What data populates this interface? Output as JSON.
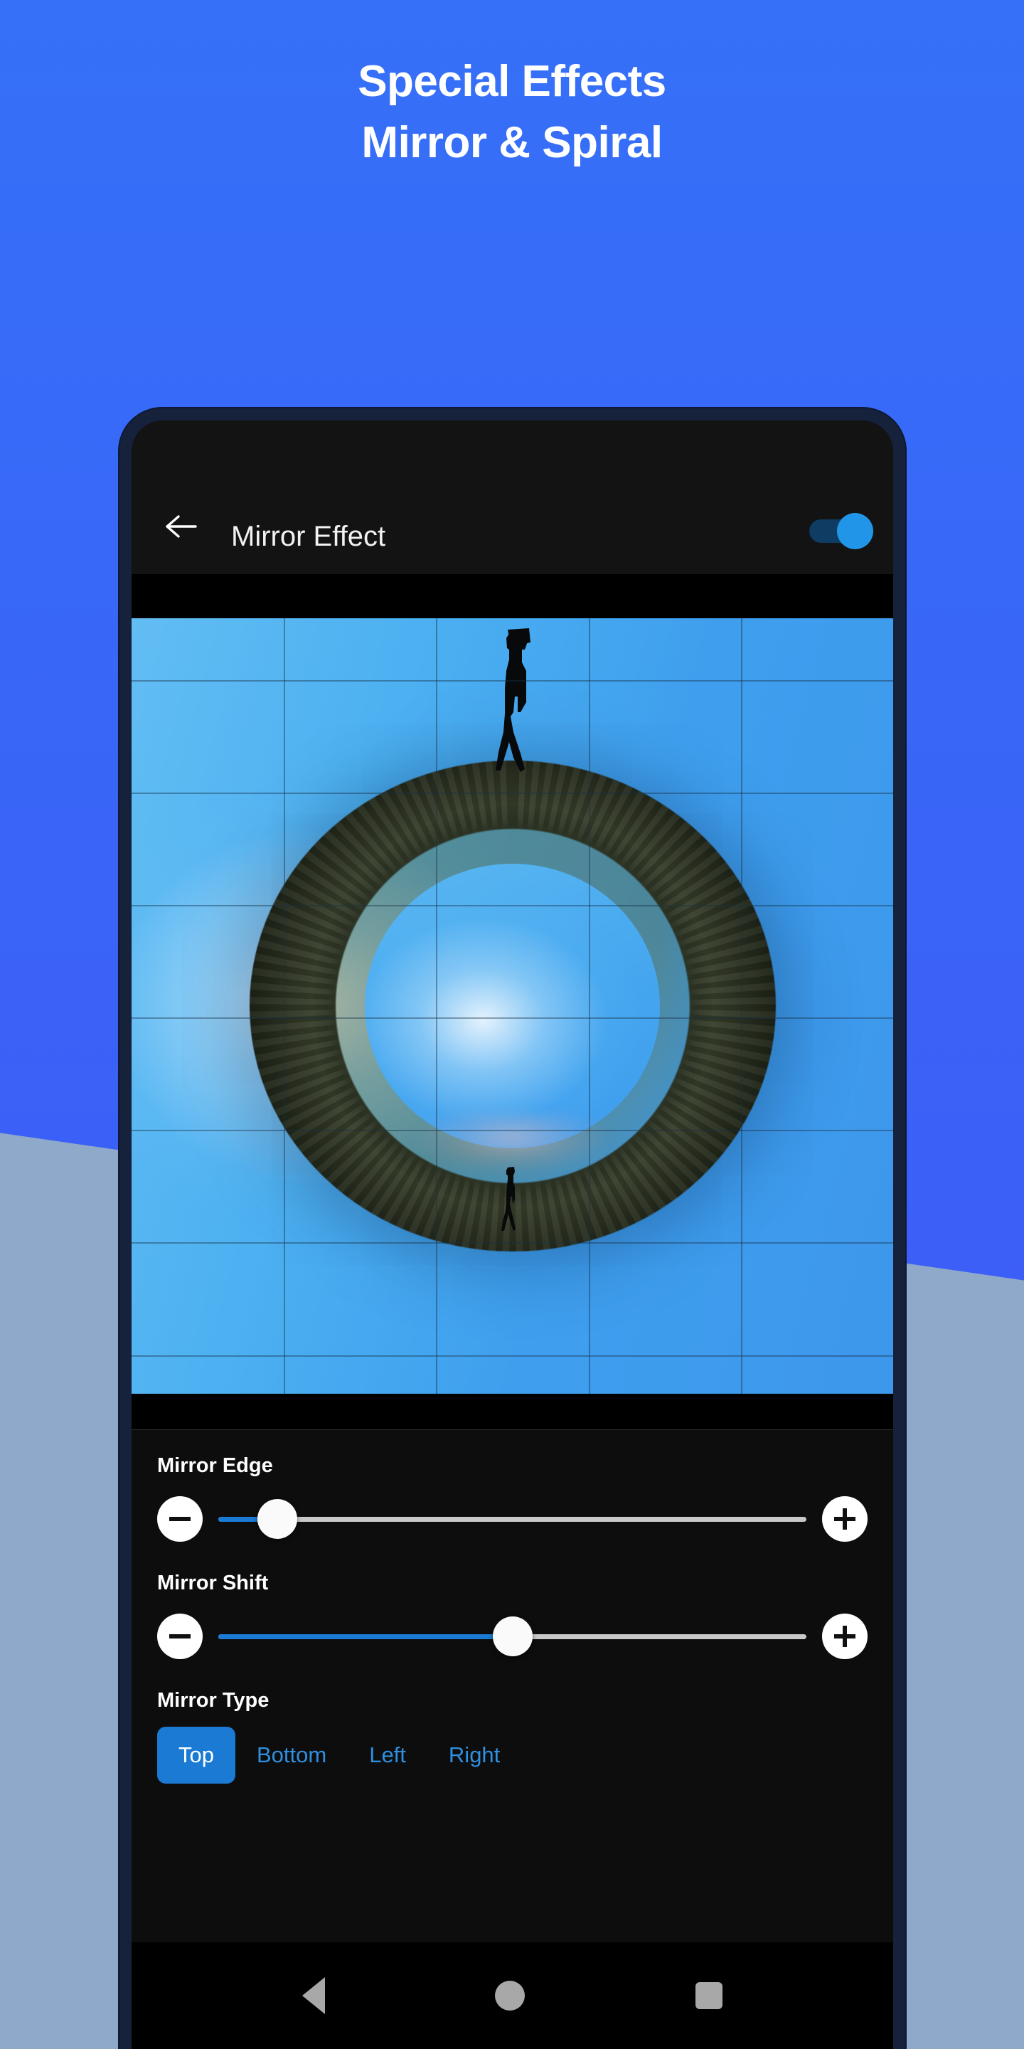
{
  "promo": {
    "headline_line1": "Special Effects",
    "headline_line2": "Mirror & Spiral",
    "bg_color": "#3a63f7",
    "bg_lower_color": "#8ea9ca",
    "headline_color": "#ffffff"
  },
  "app_bar": {
    "back_icon": "arrow-left-icon",
    "title": "Mirror Effect",
    "toggle": {
      "name": "effect-enable-toggle",
      "state": "on",
      "accent_color": "#2196e8",
      "track_color": "#0f3c63"
    },
    "background_color": "#131313"
  },
  "preview": {
    "name": "image-preview",
    "description": "Silhouette of a person walking on a circular tiny-planet island against a blue sky, mirrored vertically",
    "grid_overlay": true,
    "grid_columns": 5,
    "grid_rows": 7,
    "letterbox_color": "#000000"
  },
  "controls": {
    "background_color": "#0d0d0d",
    "accent_color": "#1a7ad4",
    "sliders": [
      {
        "name": "mirror-edge",
        "label": "Mirror Edge",
        "value_percent": 10,
        "decrease_label": "−",
        "increase_label": "+",
        "track_color": "#c8c8c8",
        "fill_color": "#1a7ad4"
      },
      {
        "name": "mirror-shift",
        "label": "Mirror Shift",
        "value_percent": 50,
        "decrease_label": "−",
        "increase_label": "+",
        "track_color": "#c8c8c8",
        "fill_color": "#1a7ad4"
      }
    ],
    "mirror_type": {
      "label": "Mirror Type",
      "selected": "Top",
      "options": [
        "Top",
        "Bottom",
        "Left",
        "Right"
      ],
      "selected_bg": "#1a7ad4",
      "selected_text": "#ffffff",
      "option_text": "#2f8fe0"
    }
  },
  "nav_bar": {
    "background_color": "#000000",
    "icon_color": "#a8a8a8",
    "items": [
      {
        "name": "nav-back-button",
        "icon": "triangle-left-icon"
      },
      {
        "name": "nav-home-button",
        "icon": "circle-icon"
      },
      {
        "name": "nav-recents-button",
        "icon": "square-icon"
      }
    ]
  }
}
